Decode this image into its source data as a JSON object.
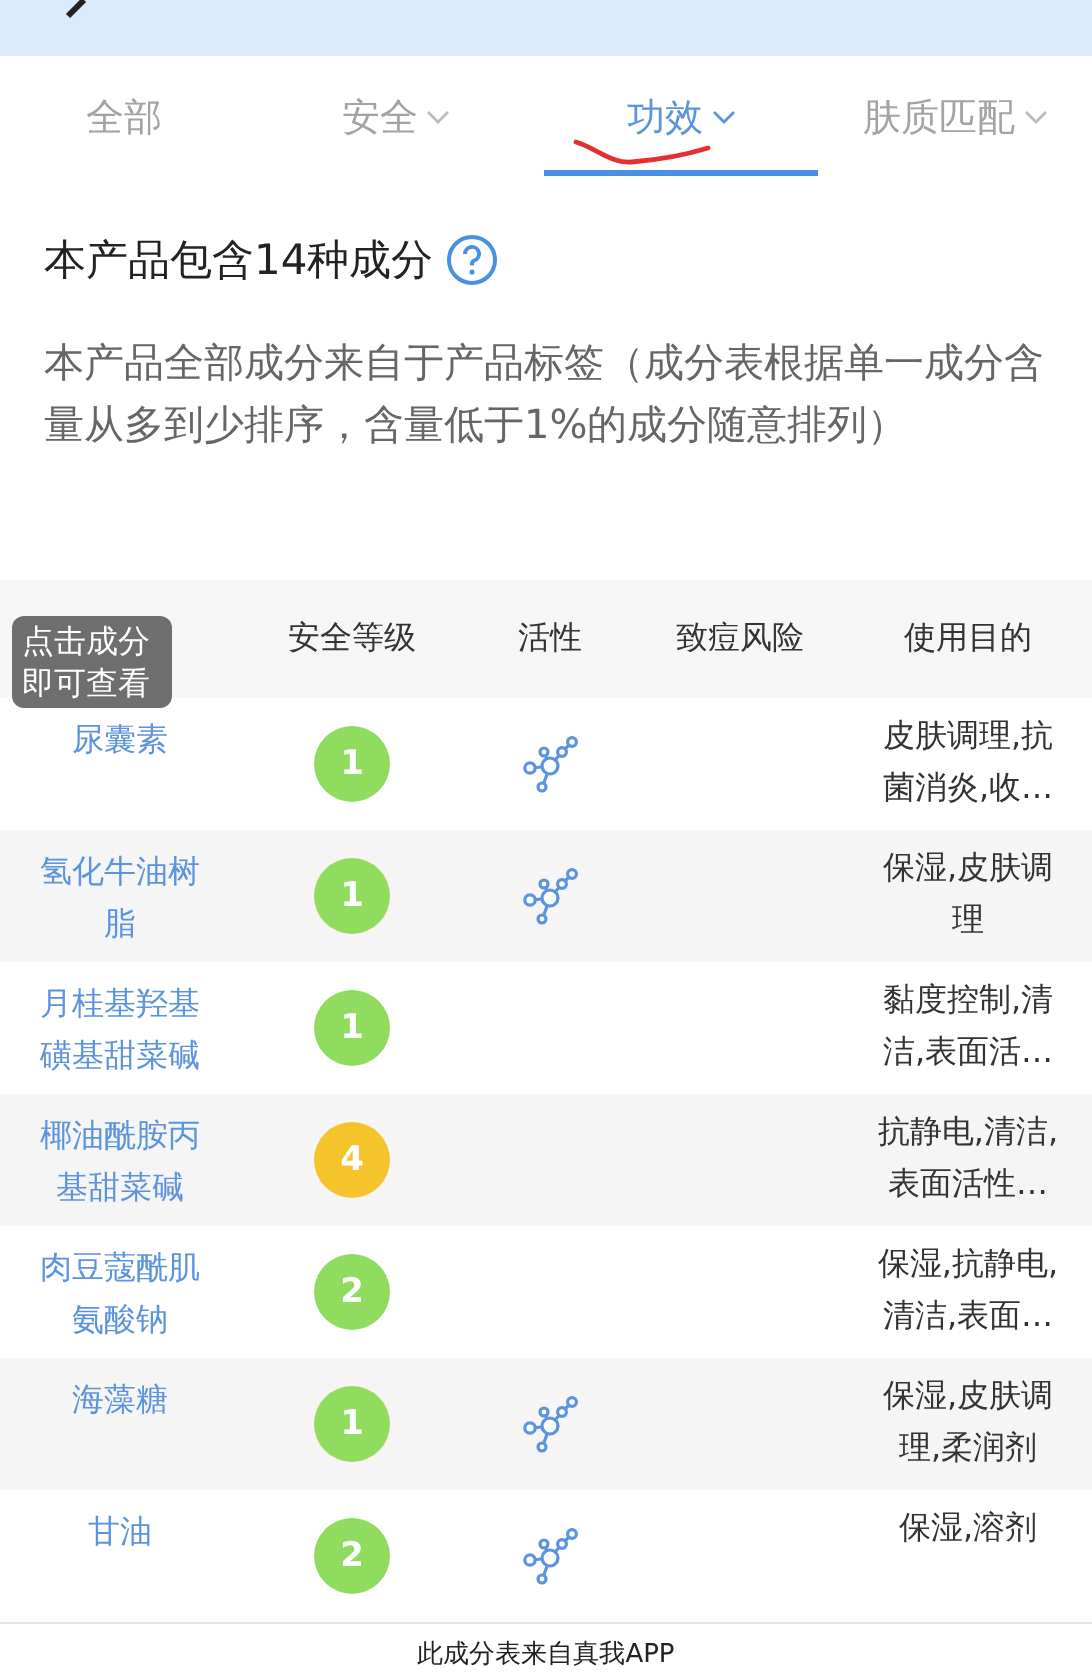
{
  "tabs": [
    {
      "label": "全部",
      "selected": false,
      "dropdown": false
    },
    {
      "label": "安全",
      "selected": false,
      "dropdown": true
    },
    {
      "label": "功效",
      "selected": true,
      "dropdown": true
    },
    {
      "label": "肤质匹配",
      "selected": false,
      "dropdown": true
    }
  ],
  "summary": {
    "title": "本产品包含14种成分",
    "description": "本产品全部成分来自于产品标签（成分表根据单一成分含量从多到少排序，含量低于1%的成分随意排列）"
  },
  "table": {
    "columns": [
      "安全等级",
      "活性",
      "致痘风险",
      "使用目的"
    ],
    "tooltip": "点击成分即可查看",
    "rows": [
      {
        "name": "尿囊素",
        "safety": "1",
        "color": "#8fdc5e",
        "active": true,
        "purpose": "皮肤调理,抗菌消炎,收…"
      },
      {
        "name": "氢化牛油树脂",
        "safety": "1",
        "color": "#8fdc5e",
        "active": true,
        "purpose": "保湿,皮肤调理"
      },
      {
        "name": "月桂基羟基磺基甜菜碱",
        "safety": "1",
        "color": "#8fdc5e",
        "active": false,
        "purpose": "黏度控制,清洁,表面活…"
      },
      {
        "name": "椰油酰胺丙基甜菜碱",
        "safety": "4",
        "color": "#f5c42c",
        "active": false,
        "purpose": "抗静电,清洁,表面活性…"
      },
      {
        "name": "肉豆蔻酰肌氨酸钠",
        "safety": "2",
        "color": "#8fdc5e",
        "active": false,
        "purpose": "保湿,抗静电,清洁,表面…"
      },
      {
        "name": "海藻糖",
        "safety": "1",
        "color": "#8fdc5e",
        "active": true,
        "purpose": "保湿,皮肤调理,柔润剂"
      },
      {
        "name": "甘油",
        "safety": "2",
        "color": "#8fdc5e",
        "active": true,
        "purpose": "保湿,溶剂"
      }
    ]
  },
  "footer": "此成分表来自真我APP"
}
